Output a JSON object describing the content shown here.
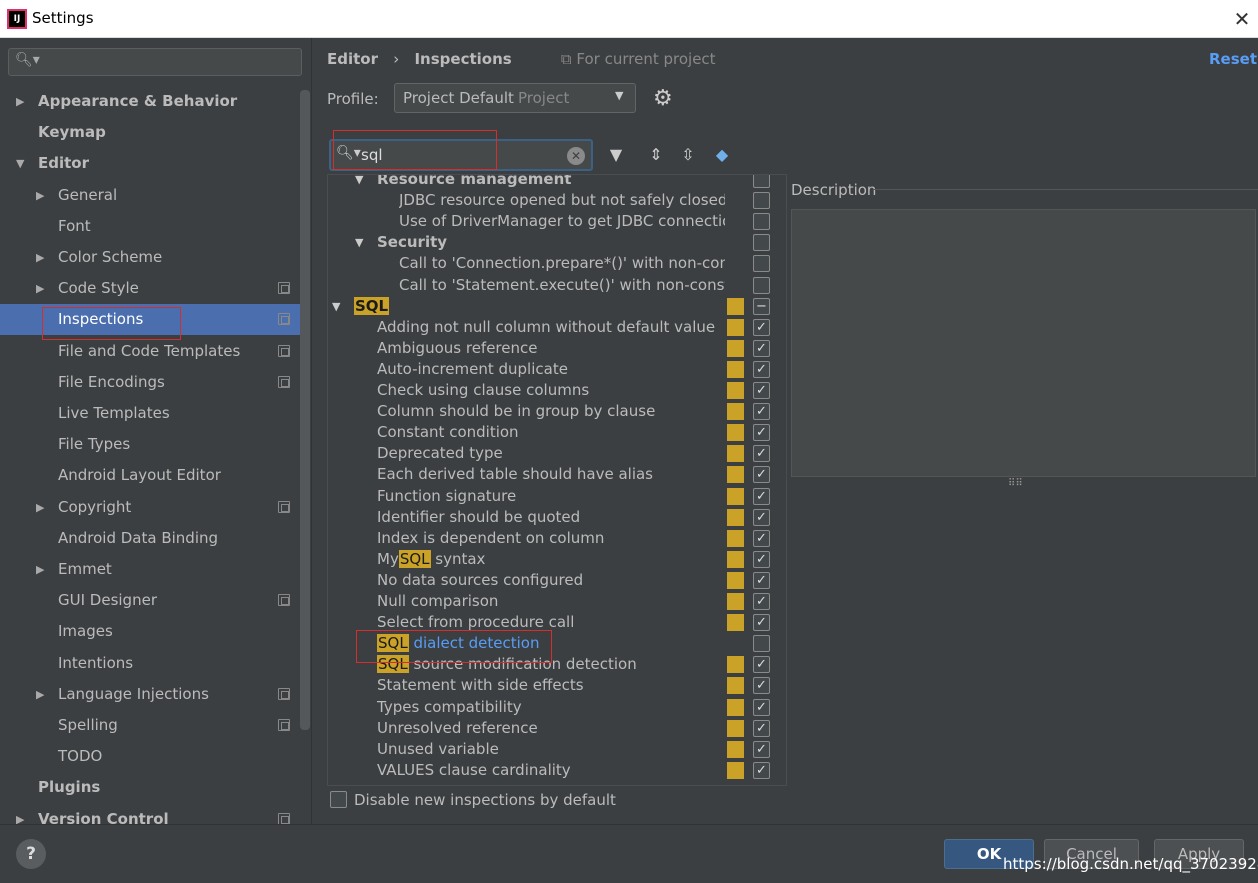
{
  "window": {
    "title": "Settings",
    "app_icon": "IJ"
  },
  "sidebar": {
    "search_placeholder": "",
    "items": [
      {
        "label": "Appearance & Behavior",
        "level": 0,
        "arrow": "▶",
        "bold": true
      },
      {
        "label": "Keymap",
        "level": 0,
        "arrow": "",
        "bold": true
      },
      {
        "label": "Editor",
        "level": 0,
        "arrow": "▼",
        "bold": true
      },
      {
        "label": "General",
        "level": 1,
        "arrow": "▶"
      },
      {
        "label": "Font",
        "level": 1,
        "arrow": ""
      },
      {
        "label": "Color Scheme",
        "level": 1,
        "arrow": "▶"
      },
      {
        "label": "Code Style",
        "level": 1,
        "arrow": "▶",
        "project": true
      },
      {
        "label": "Inspections",
        "level": 1,
        "arrow": "",
        "project": true,
        "selected": true
      },
      {
        "label": "File and Code Templates",
        "level": 1,
        "arrow": "",
        "project": true
      },
      {
        "label": "File Encodings",
        "level": 1,
        "arrow": "",
        "project": true
      },
      {
        "label": "Live Templates",
        "level": 1,
        "arrow": ""
      },
      {
        "label": "File Types",
        "level": 1,
        "arrow": ""
      },
      {
        "label": "Android Layout Editor",
        "level": 1,
        "arrow": ""
      },
      {
        "label": "Copyright",
        "level": 1,
        "arrow": "▶",
        "project": true
      },
      {
        "label": "Android Data Binding",
        "level": 1,
        "arrow": ""
      },
      {
        "label": "Emmet",
        "level": 1,
        "arrow": "▶"
      },
      {
        "label": "GUI Designer",
        "level": 1,
        "arrow": "",
        "project": true
      },
      {
        "label": "Images",
        "level": 1,
        "arrow": ""
      },
      {
        "label": "Intentions",
        "level": 1,
        "arrow": ""
      },
      {
        "label": "Language Injections",
        "level": 1,
        "arrow": "▶",
        "project": true
      },
      {
        "label": "Spelling",
        "level": 1,
        "arrow": "",
        "project": true
      },
      {
        "label": "TODO",
        "level": 1,
        "arrow": ""
      },
      {
        "label": "Plugins",
        "level": 0,
        "arrow": "",
        "bold": true
      },
      {
        "label": "Version Control",
        "level": 0,
        "arrow": "▶",
        "bold": true,
        "project": true
      }
    ]
  },
  "header": {
    "breadcrumb_editor": "Editor",
    "breadcrumb_sep": "›",
    "breadcrumb_page": "Inspections",
    "scope_note": "For current project",
    "reset": "Reset"
  },
  "profile": {
    "label": "Profile:",
    "value": "Project Default",
    "scope": "Project"
  },
  "filter": {
    "value": "sql"
  },
  "tree_rows": [
    {
      "type": "group",
      "indent": 1,
      "label": "Resource management",
      "cb": "empty"
    },
    {
      "type": "item",
      "indent": 2,
      "label": "JDBC resource opened but not safely closed",
      "cb": "empty"
    },
    {
      "type": "item",
      "indent": 2,
      "label": "Use of DriverManager to get JDBC connectio",
      "cb": "empty"
    },
    {
      "type": "group",
      "indent": 1,
      "label": "Security",
      "cb": "empty"
    },
    {
      "type": "item",
      "indent": 2,
      "label": "Call to 'Connection.prepare*()' with non-cons",
      "cb": "empty"
    },
    {
      "type": "item",
      "indent": 2,
      "label": "Call to 'Statement.execute()' with non-consta",
      "cb": "empty"
    },
    {
      "type": "group",
      "indent": 0,
      "label": "",
      "pre": "",
      "hl": "SQL",
      "post": "",
      "cb": "partial",
      "sev": true
    },
    {
      "type": "item",
      "indent": 1,
      "label": "Adding not null column without default value",
      "cb": "checked",
      "sev": true
    },
    {
      "type": "item",
      "indent": 1,
      "label": "Ambiguous reference",
      "cb": "checked",
      "sev": true
    },
    {
      "type": "item",
      "indent": 1,
      "label": "Auto-increment duplicate",
      "cb": "checked",
      "sev": true
    },
    {
      "type": "item",
      "indent": 1,
      "label": "Check using clause columns",
      "cb": "checked",
      "sev": true
    },
    {
      "type": "item",
      "indent": 1,
      "label": "Column should be in group by clause",
      "cb": "checked",
      "sev": true
    },
    {
      "type": "item",
      "indent": 1,
      "label": "Constant condition",
      "cb": "checked",
      "sev": true
    },
    {
      "type": "item",
      "indent": 1,
      "label": "Deprecated type",
      "cb": "checked",
      "sev": true
    },
    {
      "type": "item",
      "indent": 1,
      "label": "Each derived table should have alias",
      "cb": "checked",
      "sev": true
    },
    {
      "type": "item",
      "indent": 1,
      "label": "Function signature",
      "cb": "checked",
      "sev": true
    },
    {
      "type": "item",
      "indent": 1,
      "label": "Identifier should be quoted",
      "cb": "checked",
      "sev": true
    },
    {
      "type": "item",
      "indent": 1,
      "label": "Index is dependent on column",
      "cb": "checked",
      "sev": true
    },
    {
      "type": "item",
      "indent": 1,
      "label": "",
      "pre": "My",
      "hl": "SQL",
      "post": " syntax",
      "cb": "checked",
      "sev": true
    },
    {
      "type": "item",
      "indent": 1,
      "label": "No data sources configured",
      "cb": "checked",
      "sev": true
    },
    {
      "type": "item",
      "indent": 1,
      "label": "Null comparison",
      "cb": "checked",
      "sev": true
    },
    {
      "type": "item",
      "indent": 1,
      "label": "Select from procedure call",
      "cb": "checked",
      "sev": true
    },
    {
      "type": "item",
      "indent": 1,
      "label": "",
      "pre": "",
      "hl": "SQL",
      "post": " dialect detection",
      "link": true,
      "cb": "empty"
    },
    {
      "type": "item",
      "indent": 1,
      "label": "",
      "pre": "",
      "hl": "SQL",
      "post": " source modification detection",
      "cb": "checked",
      "sev": true
    },
    {
      "type": "item",
      "indent": 1,
      "label": "Statement with side effects",
      "cb": "checked",
      "sev": true
    },
    {
      "type": "item",
      "indent": 1,
      "label": "Types compatibility",
      "cb": "checked",
      "sev": true
    },
    {
      "type": "item",
      "indent": 1,
      "label": "Unresolved reference",
      "cb": "checked",
      "sev": true
    },
    {
      "type": "item",
      "indent": 1,
      "label": "Unused variable",
      "cb": "checked",
      "sev": true
    },
    {
      "type": "item",
      "indent": 1,
      "label": "VALUES clause cardinality",
      "cb": "checked",
      "sev": true
    }
  ],
  "description": {
    "label": "Description"
  },
  "disable_new": {
    "label": "Disable new inspections by default"
  },
  "footer": {
    "help": "?",
    "ok": "OK",
    "cancel": "Cancel",
    "apply": "Apply",
    "watermark": "https://blog.csdn.net/qq_37023928"
  },
  "colors": {
    "accent": "#4b6eaf",
    "severity": "#c9a227",
    "link": "#589df6"
  }
}
